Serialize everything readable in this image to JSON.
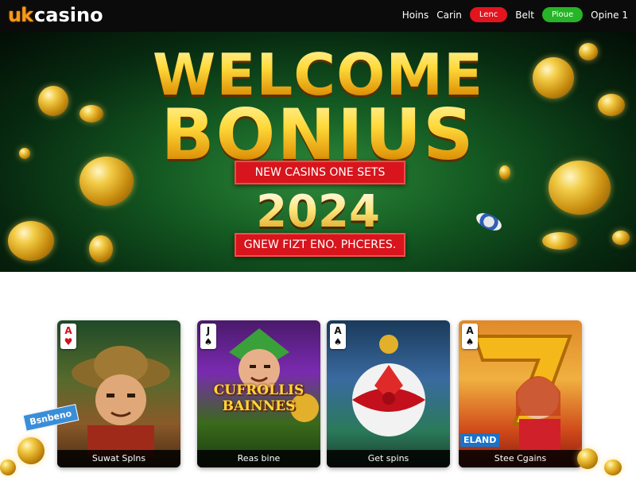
{
  "brand": {
    "logo_uk": "uk",
    "logo_casino": "casino"
  },
  "nav": {
    "items": [
      {
        "label": "Hoins",
        "style": "link"
      },
      {
        "label": "Carin",
        "style": "link"
      },
      {
        "label": "Lenc",
        "style": "pill",
        "color": "#e2141e"
      },
      {
        "label": "Belt",
        "style": "link"
      },
      {
        "label": "Pioue",
        "style": "pill",
        "color": "#26b526"
      },
      {
        "label": "Opine 1",
        "style": "link"
      }
    ]
  },
  "hero": {
    "headline_1": "WELCOME",
    "headline_2": "BONIUS",
    "banner_top": "NEW CASINS ONE SETS",
    "year": "2024",
    "banner_bottom": "GNEW FIZT ENO. PHCERES."
  },
  "games": {
    "cards": [
      {
        "caption": "Suwat Splns",
        "card_rank": "A",
        "card_suit": "♥",
        "suit_color": "red",
        "badge": ""
      },
      {
        "caption": "Reas bine",
        "card_rank": "J",
        "card_suit": "♠",
        "suit_color": "black",
        "art_title": "CUFROLLIS BAINNES"
      },
      {
        "caption": "Get spins",
        "card_rank": "A",
        "card_suit": "♠",
        "suit_color": "black"
      },
      {
        "caption": "Stee Cgains",
        "card_rank": "A",
        "card_suit": "♠",
        "suit_color": "black",
        "badge": "ELAND"
      }
    ],
    "sticker": "Bsnbeno"
  },
  "colors": {
    "accent_gold": "#ffd93a",
    "banner_red": "#d8141c",
    "hero_green": "#145a22"
  }
}
